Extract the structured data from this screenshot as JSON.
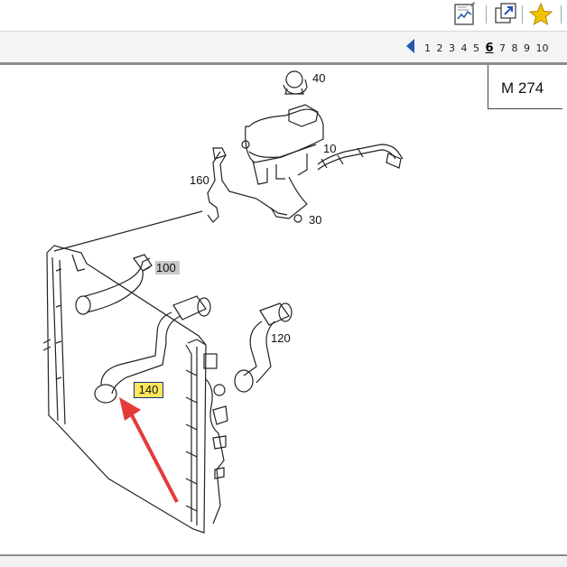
{
  "toolbar": {
    "buttons": [
      {
        "icon": "notepad-chart-icon"
      },
      {
        "icon": "external-link-icon"
      },
      {
        "icon": "star-icon",
        "color": "#f2c200"
      }
    ]
  },
  "pager": {
    "prev_icon": "prev-page-arrow-icon",
    "pages": [
      "1",
      "2",
      "3",
      "4",
      "5",
      "6",
      "7",
      "8",
      "9",
      "10"
    ],
    "current": "6"
  },
  "diagram": {
    "model": "M 274",
    "callouts": {
      "c40": "40",
      "c10": "10",
      "c160": "160",
      "c30": "30",
      "c100": "100",
      "c120": "120",
      "c140": "140"
    },
    "highlight_color": "#ffe65a",
    "arrow_color": "#e53a3a"
  }
}
